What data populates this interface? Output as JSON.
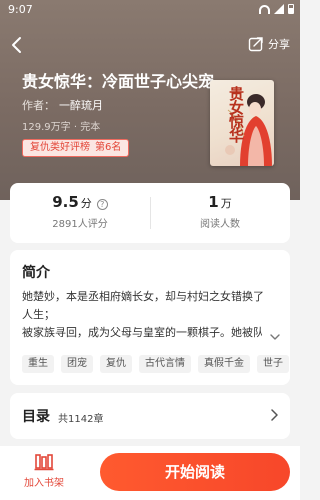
{
  "status_bar": {
    "time": "9:07"
  },
  "header": {
    "share_label": "分享"
  },
  "book": {
    "title": "贵女惊华：冷面世子心尖宠",
    "author_label": "作者：",
    "author_name": "一醉琉月",
    "word_count": "129.9万字",
    "status": "完本",
    "meta_separator": "·",
    "rank_name": "复仇类好评榜",
    "rank_position": "第6名",
    "cover_title": "贵女惊华"
  },
  "stats": {
    "score": "9.5",
    "score_unit": "分",
    "score_label": "2891人评分",
    "readers": "1",
    "readers_unit": "万",
    "readers_label": "阅读人数"
  },
  "intro": {
    "heading": "简介",
    "lines": [
      "她楚妙，本是丞相府嫡长女，却与村妇之女错换了",
      "人生；",
      "被家族寻回，成为父母与皇室的一颗棋子。她被队"
    ],
    "tags": [
      "重生",
      "团宠",
      "复仇",
      "古代言情",
      "真假千金",
      "世子"
    ]
  },
  "toc": {
    "heading": "目录",
    "chapter_count": "共1142章"
  },
  "bottom": {
    "shelf_label": "加入书架",
    "start_label": "开始阅读"
  },
  "colors": {
    "accent": "#f7472a",
    "hero_bg": "#7b6b63",
    "badge_text": "#e3483a"
  }
}
